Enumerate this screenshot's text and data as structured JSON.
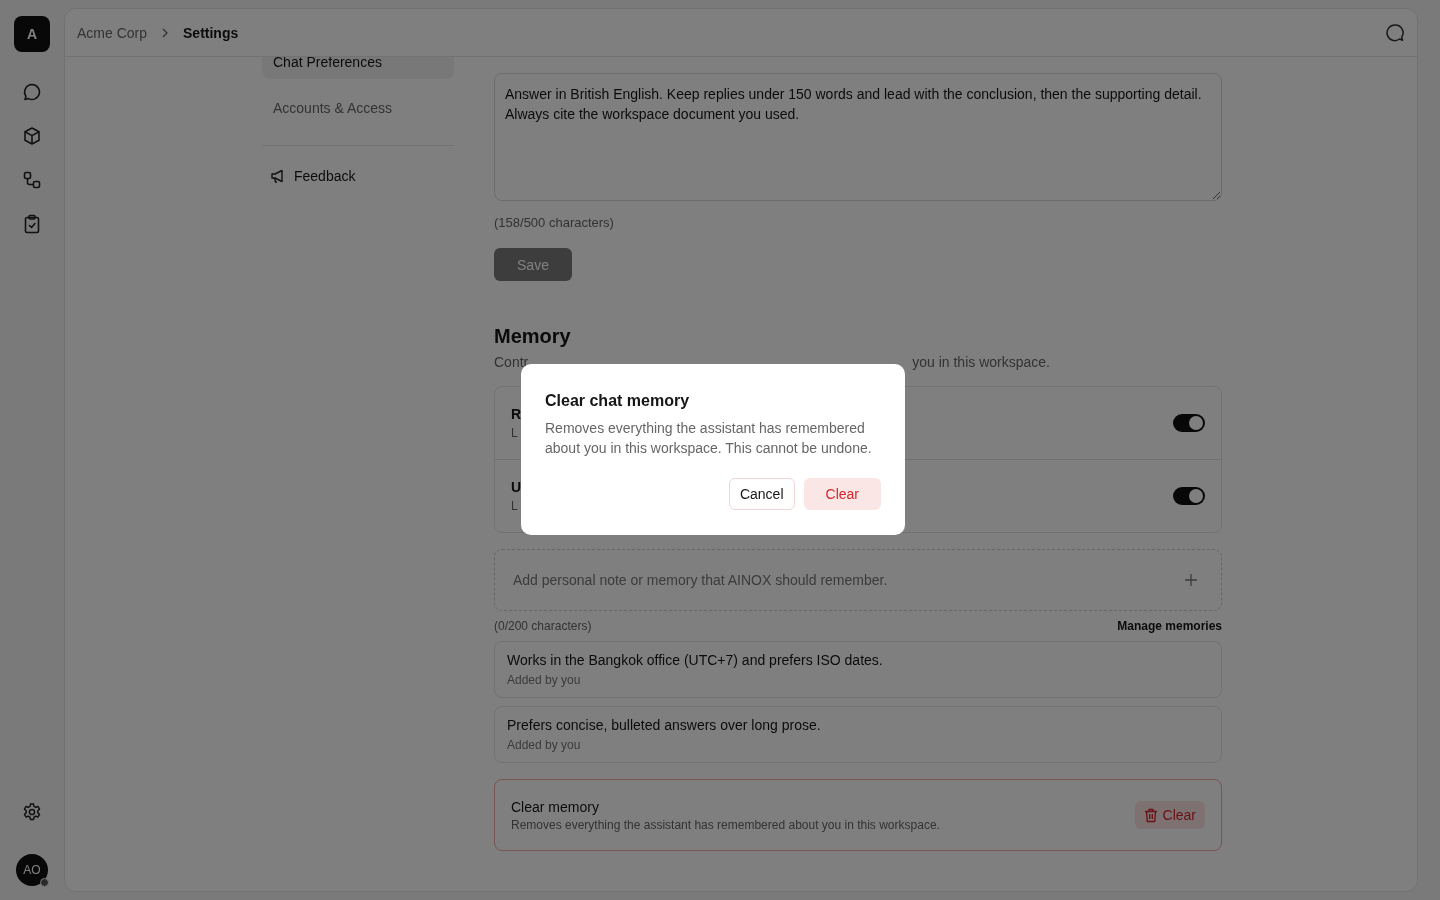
{
  "rail": {
    "logo": "A",
    "items": [
      {
        "kind": "chat"
      },
      {
        "kind": "cube"
      },
      {
        "kind": "flow"
      },
      {
        "kind": "clipboard"
      }
    ],
    "settings": {
      "kind": "gear"
    },
    "avatar": "AO"
  },
  "breadcrumb": [
    {
      "label": "Acme Corp",
      "current": false
    },
    {
      "label": "Settings",
      "current": true
    }
  ],
  "nav": {
    "items": [
      {
        "label": "Chat Preferences",
        "selected": true
      },
      {
        "label": "Accounts & Access",
        "selected": false
      }
    ],
    "feedback": "Feedback"
  },
  "instructions": {
    "value": "Answer in British English. Keep replies under 150 words and lead with the conclusion, then the supporting detail. Always cite the workspace document you used.",
    "counter": "(158/500 characters)",
    "save": {
      "label": "Save",
      "disabled": true
    }
  },
  "memory": {
    "title": "Memory",
    "description_start": "Contr",
    "description_end": "you in this workspace.",
    "toggles": [
      {
        "title": "R",
        "subtitle": "L",
        "on": true
      },
      {
        "title": "U",
        "subtitle": "L",
        "on": true
      }
    ],
    "note": {
      "placeholder": "Add personal note or memory that AINOX should remember.",
      "counter": "(0/200 characters)"
    },
    "manage": "Manage memories",
    "memories": [
      {
        "text": "Works in the Bangkok office (UTC+7) and prefers ISO dates.",
        "meta": "Added by you"
      },
      {
        "text": "Prefers concise, bulleted answers over long prose.",
        "meta": "Added by you"
      }
    ],
    "clear": {
      "title": "Clear memory",
      "description": "Removes everything the assistant has remembered about you in this workspace.",
      "button": "Clear"
    }
  },
  "dialog": {
    "title": "Clear chat memory",
    "message": "Removes everything the assistant has remembered about you in this workspace. This cannot be undone.",
    "cancel": "Cancel",
    "confirm": "Clear"
  }
}
